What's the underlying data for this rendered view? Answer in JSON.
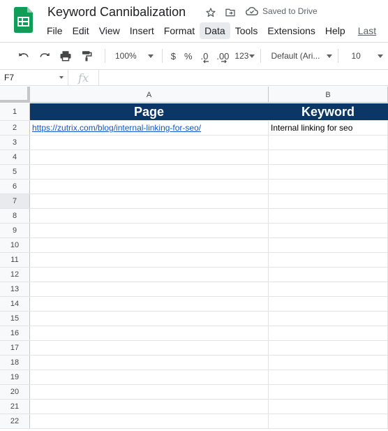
{
  "document": {
    "title": "Keyword Cannibalization",
    "save_status": "Saved to Drive",
    "icons": {
      "logo": "google-sheets-logo",
      "star": "star-icon",
      "move": "move-to-folder-icon",
      "cloud": "cloud-saved-icon"
    }
  },
  "menu": {
    "items": [
      "File",
      "Edit",
      "View",
      "Insert",
      "Format",
      "Data",
      "Tools",
      "Extensions",
      "Help"
    ],
    "active": "Data",
    "last_edit": "Last"
  },
  "toolbar": {
    "undo": "undo-icon",
    "redo": "redo-icon",
    "print": "print-icon",
    "paint_format": "paint-format-icon",
    "zoom": "100%",
    "currency": "$",
    "percent": "%",
    "decrease_decimal": ".0",
    "increase_decimal": ".00",
    "more_formats": "123",
    "font": "Default (Ari...",
    "font_size": "10"
  },
  "formula_bar": {
    "name_box": "F7",
    "fx_label": "fx",
    "formula": ""
  },
  "grid": {
    "columns": [
      "A",
      "B"
    ],
    "selected_row": "7",
    "rows": [
      {
        "num": "1",
        "a": "Page",
        "b": "Keyword"
      },
      {
        "num": "2",
        "a": "https://zutrix.com/blog/internal-linking-for-seo/",
        "b": "Internal linking for seo"
      },
      {
        "num": "3",
        "a": "",
        "b": ""
      },
      {
        "num": "4",
        "a": "",
        "b": ""
      },
      {
        "num": "5",
        "a": "",
        "b": ""
      },
      {
        "num": "6",
        "a": "",
        "b": ""
      },
      {
        "num": "7",
        "a": "",
        "b": ""
      },
      {
        "num": "8",
        "a": "",
        "b": ""
      },
      {
        "num": "9",
        "a": "",
        "b": ""
      },
      {
        "num": "10",
        "a": "",
        "b": ""
      },
      {
        "num": "11",
        "a": "",
        "b": ""
      },
      {
        "num": "12",
        "a": "",
        "b": ""
      },
      {
        "num": "13",
        "a": "",
        "b": ""
      },
      {
        "num": "14",
        "a": "",
        "b": ""
      },
      {
        "num": "15",
        "a": "",
        "b": ""
      },
      {
        "num": "16",
        "a": "",
        "b": ""
      },
      {
        "num": "17",
        "a": "",
        "b": ""
      },
      {
        "num": "18",
        "a": "",
        "b": ""
      },
      {
        "num": "19",
        "a": "",
        "b": ""
      },
      {
        "num": "20",
        "a": "",
        "b": ""
      },
      {
        "num": "21",
        "a": "",
        "b": ""
      },
      {
        "num": "22",
        "a": "",
        "b": ""
      }
    ]
  },
  "colors": {
    "header_fill": "#0b3666",
    "link": "#1155cc",
    "sheets_green": "#0f9d58"
  }
}
